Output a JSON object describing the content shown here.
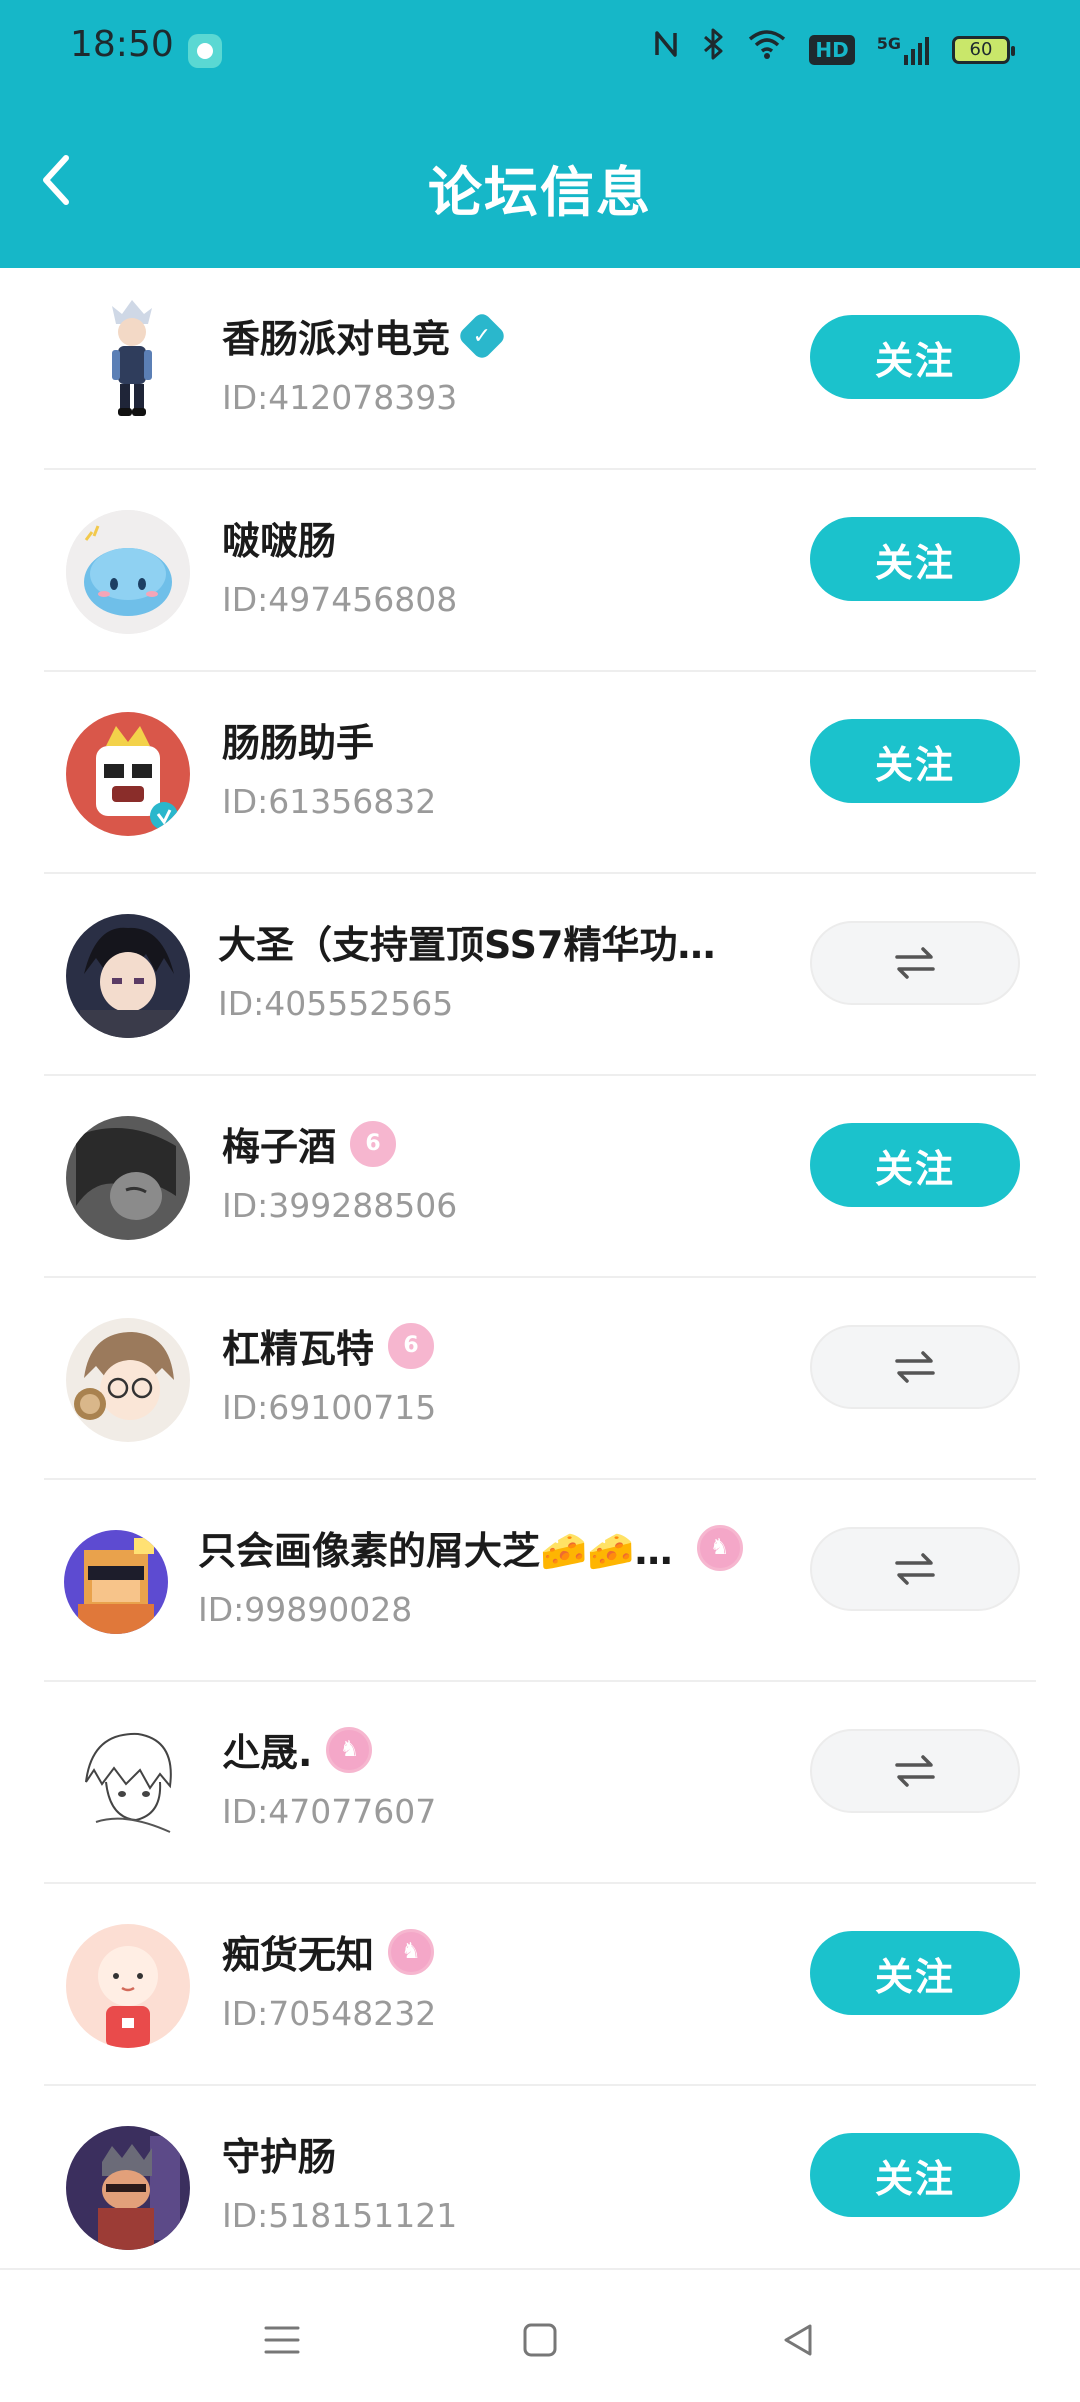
{
  "status_bar": {
    "time": "18:50",
    "battery": "60",
    "network": "5G",
    "hd": "HD",
    "icons": [
      "nfc-icon",
      "bluetooth-icon",
      "wifi-icon",
      "hd-icon",
      "signal-icon",
      "battery-icon"
    ]
  },
  "header": {
    "title": "论坛信息",
    "back_icon": "chevron-left-icon",
    "background_color": "#16b7c8"
  },
  "actions": {
    "follow_label": "关注",
    "mutual_icon": "mutual-follow-icon"
  },
  "users": [
    {
      "name": "香肠派对电竞",
      "id": "ID:412078393",
      "badge": "verified",
      "state": "follow"
    },
    {
      "name": "啵啵肠",
      "id": "ID:497456808",
      "badge": "",
      "state": "follow"
    },
    {
      "name": "肠肠助手",
      "id": "ID:61356832",
      "badge": "",
      "state": "follow"
    },
    {
      "name": "大圣（支持置顶SS7精华功…",
      "id": "ID:405552565",
      "badge": "",
      "state": "mutual"
    },
    {
      "name": "梅子酒",
      "id": "ID:399288506",
      "badge": "level",
      "state": "follow"
    },
    {
      "name": "杠精瓦特",
      "id": "ID:69100715",
      "badge": "level",
      "state": "mutual"
    },
    {
      "name": "只会画像素的屑大芝🧀🧀…",
      "id": "ID:99890028",
      "badge": "level",
      "state": "mutual"
    },
    {
      "name": "尐晟.",
      "id": "ID:47077607",
      "badge": "level",
      "state": "mutual"
    },
    {
      "name": "痴货无知",
      "id": "ID:70548232",
      "badge": "level",
      "state": "follow"
    },
    {
      "name": "守护肠",
      "id": "ID:518151121",
      "badge": "",
      "state": "follow"
    }
  ],
  "nav": {
    "icons": [
      "menu-icon",
      "home-square-icon",
      "back-triangle-icon"
    ]
  },
  "colors": {
    "accent": "#1bc2cc",
    "level_badge": "#f6b6cf"
  }
}
